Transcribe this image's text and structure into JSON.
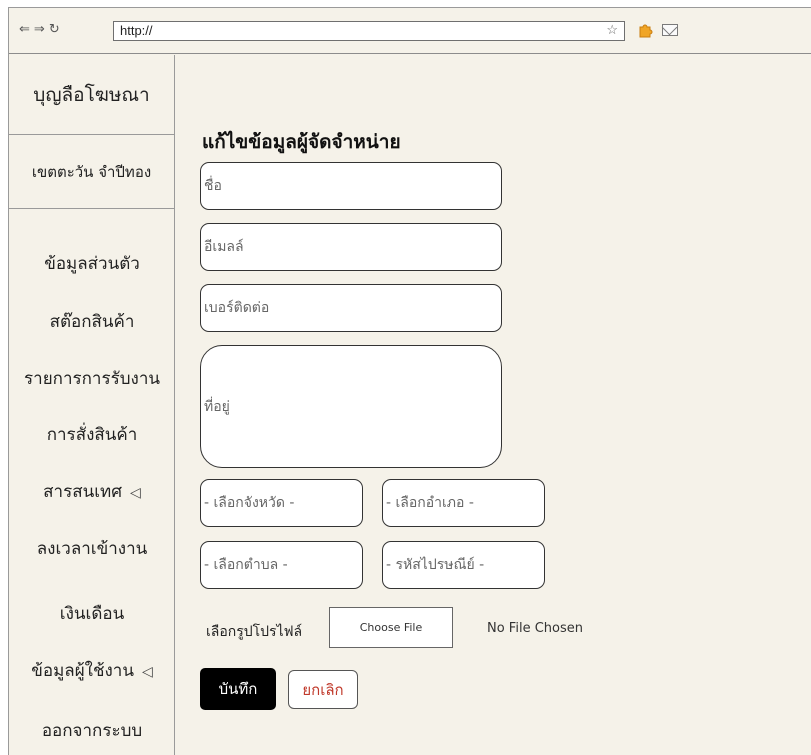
{
  "browser": {
    "nav_icons": [
      "⇐",
      "⇒",
      "↻"
    ],
    "url": "http://",
    "bookmark_icon": "star-icon",
    "extension_icon": "puzzle-icon",
    "mail_icon": "mail-icon"
  },
  "sidebar": {
    "brand": "บุญลือโฆษณา",
    "user": "เขตตะวัน จำปีทอง",
    "items": [
      {
        "label": "ข้อมูลส่วนตัว",
        "arrow": ""
      },
      {
        "label": "สต๊อกสินค้า",
        "arrow": ""
      },
      {
        "label": "รายการการรับงาน",
        "arrow": ""
      },
      {
        "label": "การสั่งสินค้า",
        "arrow": ""
      },
      {
        "label": "สารสนเทศ",
        "arrow": "◁"
      },
      {
        "label": "ลงเวลาเข้างาน",
        "arrow": ""
      },
      {
        "label": "เงินเดือน",
        "arrow": ""
      },
      {
        "label": "ข้อมูลผู้ใช้งาน",
        "arrow": "◁"
      },
      {
        "label": "ออกจากระบบ",
        "arrow": ""
      }
    ]
  },
  "form": {
    "title": "แก้ไขข้อมูลผู้จัดจำหน่าย",
    "name_placeholder": "ชื่อ",
    "email_placeholder": "อีเมลล์",
    "phone_placeholder": "เบอร์ติดต่อ",
    "address_placeholder": "ที่อยู่",
    "province_select": "- เลือกจังหวัด -",
    "district_select": "- เลือกอำเภอ -",
    "subdistrict_select": "- เลือกตำบล -",
    "postcode_select": "- รหัสไปรษณีย์ -",
    "profile_label": "เลือกรูปโปรไฟล์",
    "choose_file": "Choose File",
    "no_file": "No File Chosen",
    "save": "บันทึก",
    "cancel": "ยกเลิก"
  },
  "colors": {
    "background": "#f5f2e9",
    "save_button": "#000000",
    "cancel_text": "#c0392b"
  }
}
